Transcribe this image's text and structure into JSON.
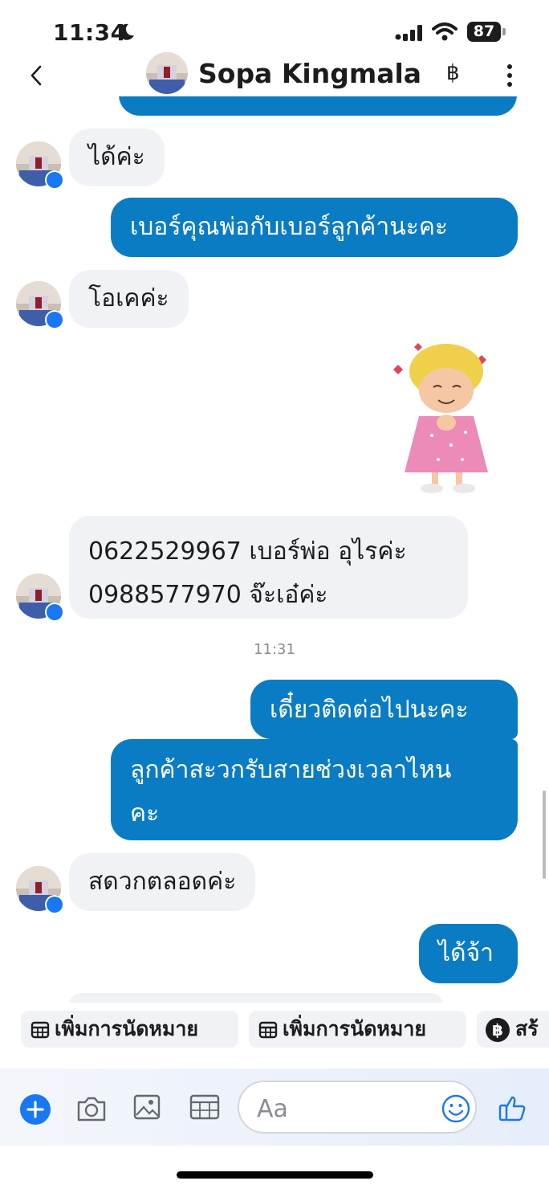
{
  "status_bar": {
    "time": "11:34",
    "battery": "87"
  },
  "header": {
    "contact_name": "Sopa Kingmala",
    "currency_icon": "baht-icon"
  },
  "messages": [
    {
      "side": "in",
      "text": "ได้ค่ะ"
    },
    {
      "side": "out",
      "text": "เบอร์คุณพ่อกับเบอร์ลูกค้านะคะ"
    },
    {
      "side": "in",
      "text": "โอเคค่ะ"
    },
    {
      "side": "out",
      "type": "sticker",
      "sticker": "girl-with-hearts-sticker"
    },
    {
      "side": "in",
      "lines": [
        "0622529967 เบอร์พ่อ อุไรค่ะ",
        "0988577970 จ๊ะเอ๋ค่ะ"
      ]
    },
    {
      "side": "out",
      "text": "เดี๋ยวติดต่อไปนะคะ"
    },
    {
      "side": "out",
      "lines": [
        "ลูกค้าสะวกรับสายช่วงเวลาไหน",
        "คะ"
      ]
    },
    {
      "side": "in",
      "text": "สดวกตลอดค่ะ"
    },
    {
      "side": "out",
      "text": "ได้จ้า"
    }
  ],
  "timestamp": "11:31",
  "quick_actions": [
    {
      "label": "เพิ่มการนัดหมาย",
      "icon": "calendar-icon"
    },
    {
      "label": "เพิ่มการนัดหมาย",
      "icon": "calendar-icon"
    },
    {
      "label": "สร้",
      "icon": "baht-icon"
    }
  ],
  "composer": {
    "placeholder": "Aa"
  },
  "colors": {
    "outgoing": "#0a7cc4",
    "incoming": "#f0f2f5",
    "accent": "#1877f2"
  }
}
